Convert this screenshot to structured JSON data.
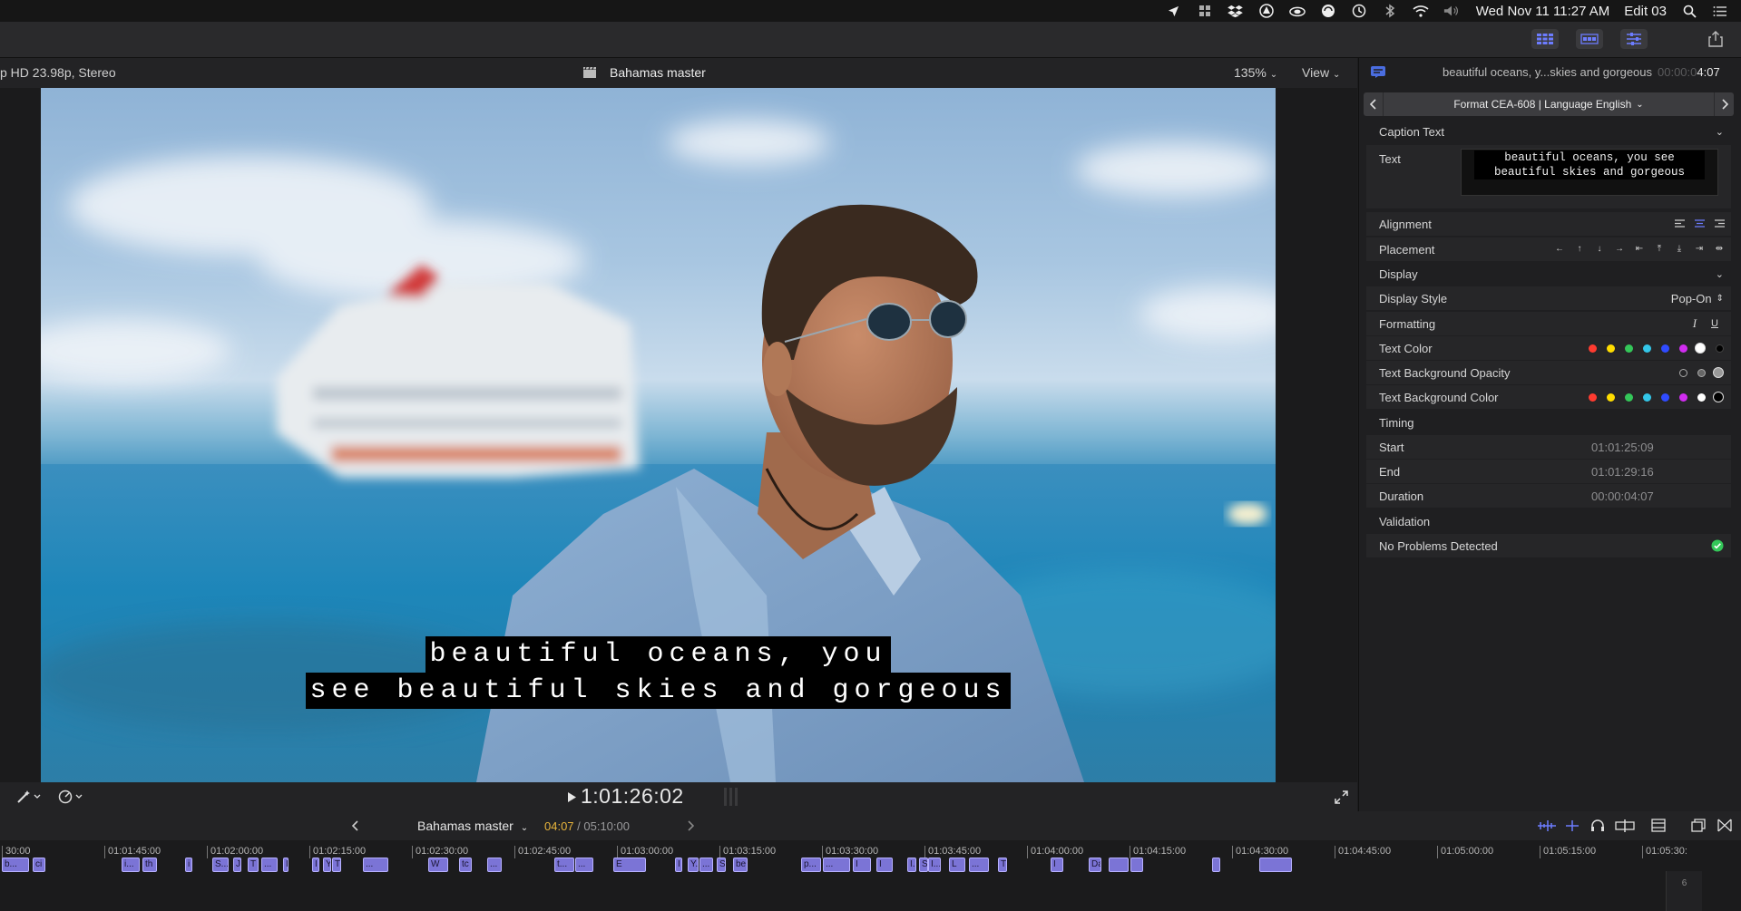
{
  "menubar": {
    "datetime": "Wed Nov 11  11:27 AM",
    "project": "Edit 03",
    "icons": [
      "location-arrow-icon",
      "grid-icon",
      "dropbox-icon",
      "triangle-icon",
      "cloud-icon",
      "sync-icon",
      "time-machine-icon",
      "bluetooth-icon",
      "wifi-icon",
      "volume-icon",
      "search-icon",
      "list-icon"
    ]
  },
  "viewer": {
    "format": "p HD 23.98p, Stereo",
    "project_name": "Bahamas master",
    "zoom": "135%",
    "view_label": "View",
    "timecode": "1:01:26:02",
    "caption_lines": [
      "beautiful oceans, you",
      "see beautiful skies and gorgeous"
    ]
  },
  "inspector": {
    "header_title": "beautiful oceans, y...skies and gorgeous",
    "header_time_dim": "00:00:0",
    "header_time": "4:07",
    "format_label": "Format CEA-608 | Language English",
    "caption_text_section": "Caption Text",
    "text_label": "Text",
    "text_value": "beautiful oceans, you see beautiful skies and gorgeous",
    "alignment_label": "Alignment",
    "placement_label": "Placement",
    "display_section": "Display",
    "display_style_label": "Display Style",
    "display_style_value": "Pop-On",
    "formatting_label": "Formatting",
    "italic_label": "I",
    "underline_label": "U",
    "text_color_label": "Text Color",
    "text_bg_opacity_label": "Text Background Opacity",
    "text_bg_color_label": "Text Background Color",
    "colors": [
      "#ff3b30",
      "#ffdd00",
      "#34c759",
      "#33c6e8",
      "#2f4bff",
      "#d12cf0"
    ],
    "timing_section": "Timing",
    "start_label": "Start",
    "start_value": "01:01:25:09",
    "end_label": "End",
    "end_value": "01:01:29:16",
    "duration_label": "Duration",
    "duration_value": "00:00:04:07",
    "validation_section": "Validation",
    "validation_value": "No Problems Detected",
    "accent_green": "#34c759"
  },
  "timeline": {
    "project_name": "Bahamas master",
    "position": "04:07",
    "total": " / 05:10:00",
    "ruler_labels": [
      "30:00",
      "01:01:45:00",
      "01:02:00:00",
      "01:02:15:00",
      "01:02:30:00",
      "01:02:45:00",
      "01:03:00:00",
      "01:03:15:00",
      "01:03:30:00",
      "01:03:45:00",
      "01:04:00:00",
      "01:04:15:00",
      "01:04:30:00",
      "01:04:45:00",
      "01:05:00:00",
      "01:05:15:00",
      "01:05:30:"
    ],
    "clip_labels": [
      "b...",
      "ci",
      "i...",
      "th",
      "i",
      "S...",
      "J",
      "T",
      "...",
      "I",
      "I",
      "Y",
      "Th...",
      "...",
      "W",
      "tc",
      "...",
      "t...",
      "...",
      "E",
      "I",
      "Y...",
      "...",
      "S...",
      "be...",
      "p...",
      "...",
      "I",
      "I",
      "I...",
      "S...",
      "I...",
      "L",
      "...",
      "T",
      "I",
      "Da..."
    ],
    "side_number": "6"
  }
}
